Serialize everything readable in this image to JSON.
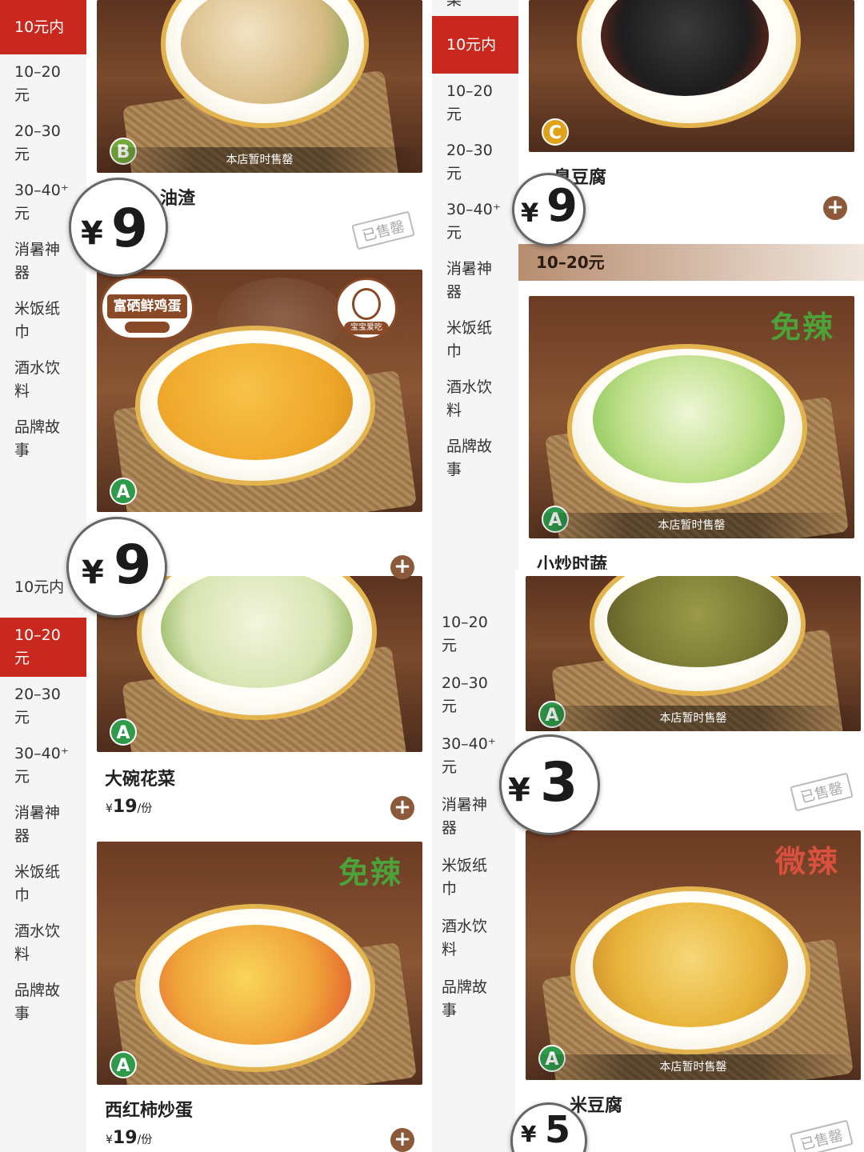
{
  "sidebar_labels": {
    "under10": "10元内",
    "r10_20": "10–20\n元",
    "r20_30": "20–30\n元",
    "r30_40": "30–40⁺\n元",
    "summer": "消暑神\n器",
    "napkin": "米饭纸\n巾",
    "drinks": "酒水饮\n料",
    "brand": "品牌故\n事"
  },
  "partial_top": {
    "left": "",
    "right": "菜"
  },
  "common": {
    "soldout_banner": "本店暂时售罄",
    "soldout_stamp": "已售罄",
    "add": "+",
    "unit": "/份",
    "yen": "¥"
  },
  "dishes": {
    "youzha": {
      "name_partial": "油渣",
      "grade": "B"
    },
    "egg": {
      "grade": "A",
      "logo": "富硒鲜鸡蛋",
      "kid_badge": "宝宝爱吃",
      "name_partial": ""
    },
    "cauliflower": {
      "name": "大碗花菜",
      "price": "19",
      "grade": "A"
    },
    "tomato_egg": {
      "name": "西红柿炒蛋",
      "price": "19",
      "grade": "A",
      "tag": "免辣"
    },
    "tofu": {
      "name_partial": "臭豆腐",
      "grade": "C"
    },
    "veg": {
      "name": "小炒时蔬",
      "grade": "A",
      "tag": "免辣"
    },
    "peas": {
      "grade": "A"
    },
    "potato": {
      "name_partial": "米豆腐",
      "grade": "A",
      "tag": "微辣"
    }
  },
  "section": {
    "title": "10–20元"
  },
  "magnifiers": {
    "m1": "9",
    "m2": "9",
    "m3": "9",
    "m4": "3",
    "m5": "5"
  },
  "colors": {
    "accent_red": "#c8281e",
    "add_button": "#8c5a3a",
    "grade_green": "#2f9a4a",
    "tag_green": "#4aa238",
    "tag_red": "#d9503e"
  },
  "icons": [
    "add-icon",
    "grade-badge",
    "kid-friendly-icon",
    "egg-logo"
  ]
}
